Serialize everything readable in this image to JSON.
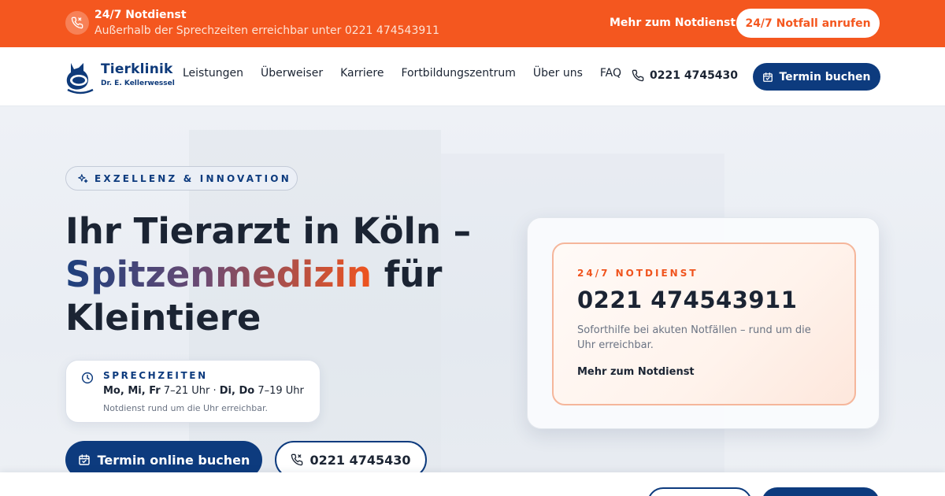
{
  "topbar": {
    "title": "24/7 Notdienst",
    "subtitle": "Außerhalb der Sprechzeiten erreichbar unter 0221 474543911",
    "more_link": "Mehr zum Notdienst",
    "call_button": "24/7 Notfall anrufen",
    "accent_color": "#f4571f"
  },
  "nav": {
    "logo_name": "Tierklinik",
    "logo_sub": "Dr. E. Kellerwessel",
    "items": [
      "Leistungen",
      "Überweiser",
      "Karriere",
      "Fortbildungszentrum",
      "Über uns",
      "FAQ"
    ],
    "phone": "0221 4745430",
    "book_button": "Termin buchen",
    "brand_color": "#0d3b7e"
  },
  "hero": {
    "badge": "EXZELLENZ & INNOVATION",
    "headline_part1": "Ihr Tierarzt in Köln –",
    "headline_highlight": "Spitzenmedizin",
    "headline_part2": "für",
    "headline_part3": "Kleintiere",
    "hours": {
      "label": "SPRECHZEITEN",
      "days1": "Mo, Mi, Fr",
      "time1": "7–21 Uhr",
      "separator": "·",
      "days2": "Di, Do",
      "time2": "7–19 Uhr",
      "note": "Notdienst rund um die Uhr erreichbar."
    },
    "cta_primary": "Termin online buchen",
    "cta_secondary": "0221 4745430"
  },
  "emergency_card": {
    "label": "24/7 NOTDIENST",
    "number": "0221 474543911",
    "description": "Soforthilfe bei akuten Notfällen – rund um die Uhr erreichbar.",
    "more_link": "Mehr zum Notdienst"
  },
  "icons": [
    "phone-icon",
    "calendar-icon",
    "clock-icon",
    "sparkle-icon",
    "logo-icon"
  ]
}
